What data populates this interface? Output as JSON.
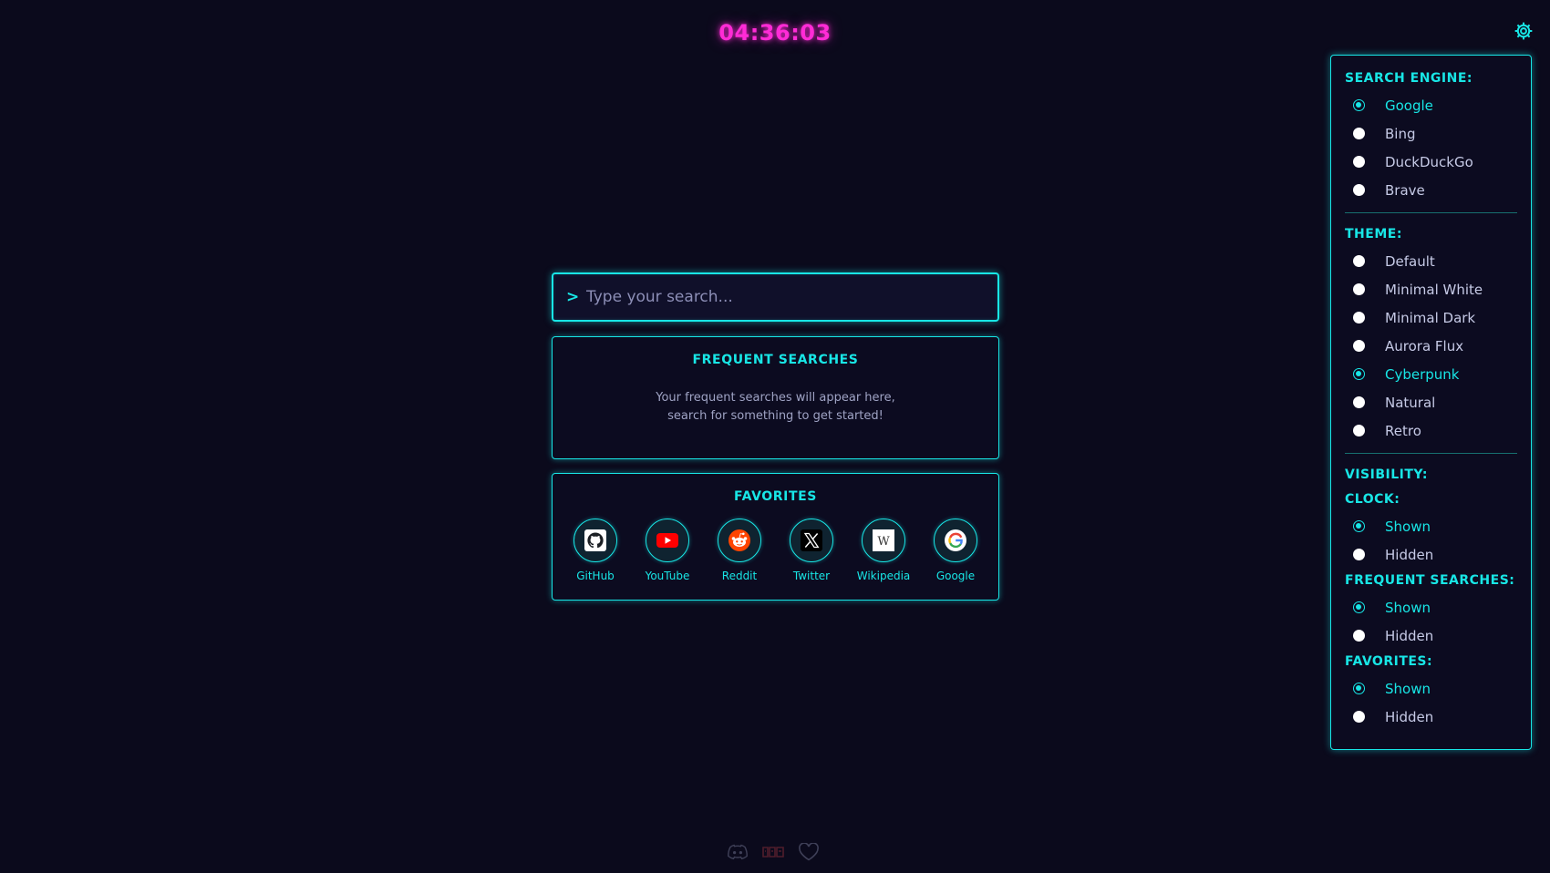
{
  "clock": {
    "time": "04:36:03"
  },
  "search": {
    "prompt": ">",
    "placeholder": "Type your search..."
  },
  "frequent": {
    "title": "FREQUENT SEARCHES",
    "empty_line1": "Your frequent searches will appear here,",
    "empty_line2": "search for something to get started!"
  },
  "favorites": {
    "title": "FAVORITES",
    "items": [
      {
        "label": "GitHub",
        "icon": "github-icon"
      },
      {
        "label": "YouTube",
        "icon": "youtube-icon"
      },
      {
        "label": "Reddit",
        "icon": "reddit-icon"
      },
      {
        "label": "Twitter",
        "icon": "x-twitter-icon"
      },
      {
        "label": "Wikipedia",
        "icon": "wikipedia-icon"
      },
      {
        "label": "Google",
        "icon": "google-icon"
      }
    ]
  },
  "settings": {
    "search_engine": {
      "heading": "SEARCH ENGINE:",
      "options": [
        "Google",
        "Bing",
        "DuckDuckGo",
        "Brave"
      ],
      "selected": "Google"
    },
    "theme": {
      "heading": "THEME:",
      "options": [
        "Default",
        "Minimal White",
        "Minimal Dark",
        "Aurora Flux",
        "Cyberpunk",
        "Natural",
        "Retro"
      ],
      "selected": "Cyberpunk"
    },
    "visibility": {
      "heading": "VISIBILITY:",
      "clock": {
        "heading": "CLOCK:",
        "options": [
          "Shown",
          "Hidden"
        ],
        "selected": "Shown"
      },
      "frequent": {
        "heading": "FREQUENT SEARCHES:",
        "options": [
          "Shown",
          "Hidden"
        ],
        "selected": "Shown"
      },
      "favorites": {
        "heading": "FAVORITES:",
        "options": [
          "Shown",
          "Hidden"
        ],
        "selected": "Shown"
      }
    }
  },
  "footer": {
    "icons": [
      "discord-icon",
      "brand-logo-icon",
      "heart-icon"
    ]
  },
  "colors": {
    "accent": "#18e6e6",
    "clock": "#ff2bd6",
    "background": "#0b0a1c"
  }
}
